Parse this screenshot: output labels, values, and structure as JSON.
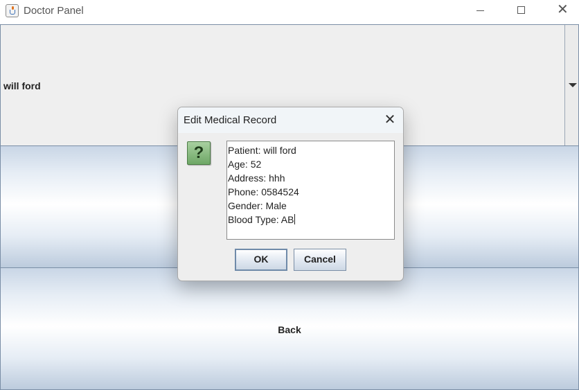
{
  "window": {
    "title": "Doctor Panel",
    "icon": "java-cup-icon",
    "controls": [
      "minimize-icon",
      "maximize-icon",
      "close-icon"
    ]
  },
  "patient_combo": {
    "selected": "will ford"
  },
  "buttons": {
    "middle_label": "",
    "back_label": "Back"
  },
  "dialog": {
    "title": "Edit Medical Record",
    "close_glyph": "✕",
    "icon": "question-icon",
    "icon_glyph": "?",
    "record_lines": [
      "Patient: will ford",
      "Age: 52",
      "Address: hhh",
      "Phone: 0584524",
      "Gender: Male",
      "Blood Type: AB"
    ],
    "ok_label": "OK",
    "cancel_label": "Cancel"
  },
  "colors": {
    "dialog_icon_green": "#6ea766",
    "button_gradient_edge": "#bccbdd"
  }
}
